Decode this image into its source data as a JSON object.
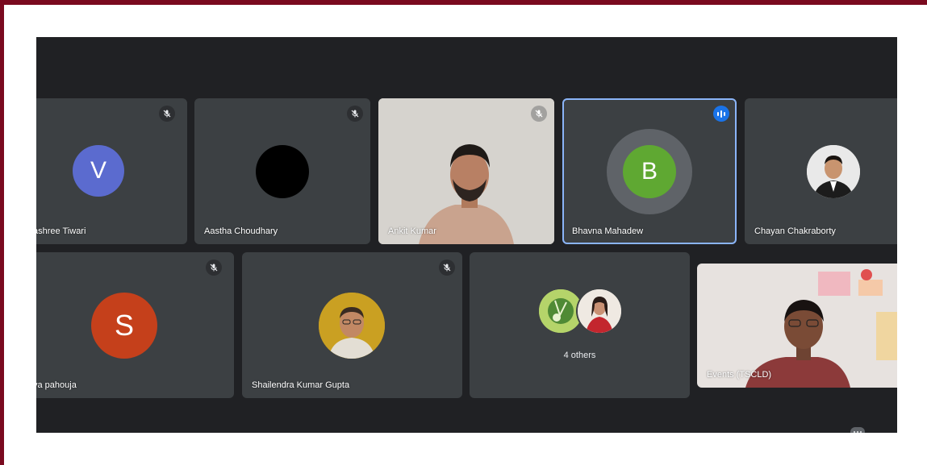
{
  "participants": [
    {
      "name": "ashree Tiwari",
      "initial": "V",
      "avatar_color": "#5b6bcf",
      "mic": "muted"
    },
    {
      "name": "Aastha Choudhary",
      "initial": "",
      "avatar_color": "#000000",
      "mic": "muted"
    },
    {
      "name": "Ankit Kumar",
      "video": "camera-on",
      "mic": "muted"
    },
    {
      "name": "Bhavna Mahadew",
      "initial": "B",
      "avatar_color": "#5fa832",
      "mic": "speaking"
    },
    {
      "name": "Chayan Chakraborty",
      "avatar": "profile-photo",
      "mic": "none"
    },
    {
      "name": "ya pahouja",
      "initial": "S",
      "avatar_color": "#c5401b",
      "mic": "muted"
    },
    {
      "name": "Shailendra Kumar Gupta",
      "avatar": "profile-photo",
      "mic": "muted"
    },
    {
      "name": "Events (TSCLD)",
      "video": "camera-on",
      "mic": "none"
    }
  ],
  "others_tile": {
    "label": "4 others"
  },
  "icons": {
    "mute": "mic-off-icon",
    "speaking": "audio-levels-icon",
    "overflow": "more-options-icon"
  },
  "colors": {
    "frame": "#7a0a1f",
    "stage_background": "#202124",
    "tile_background": "#3c4043",
    "speaking_outline": "#8ab4f8"
  }
}
